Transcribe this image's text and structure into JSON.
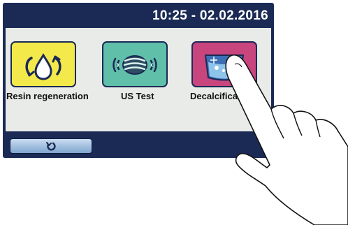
{
  "status_bar": {
    "datetime": "10:25 - 02.02.2016"
  },
  "menu": {
    "items": [
      {
        "label": "Resin regeneration",
        "icon": "resin-regeneration-icon",
        "color": "#f4e94a"
      },
      {
        "label": "US Test",
        "icon": "ultrasonic-test-icon",
        "color": "#5fbfa9"
      },
      {
        "label": "Decalcification",
        "icon": "decalcification-icon",
        "color": "#c9457e"
      }
    ]
  },
  "footer": {
    "back_icon": "return-arrow-icon"
  },
  "colors": {
    "frame": "#1b2a55",
    "panel": "#e8ebe8"
  }
}
